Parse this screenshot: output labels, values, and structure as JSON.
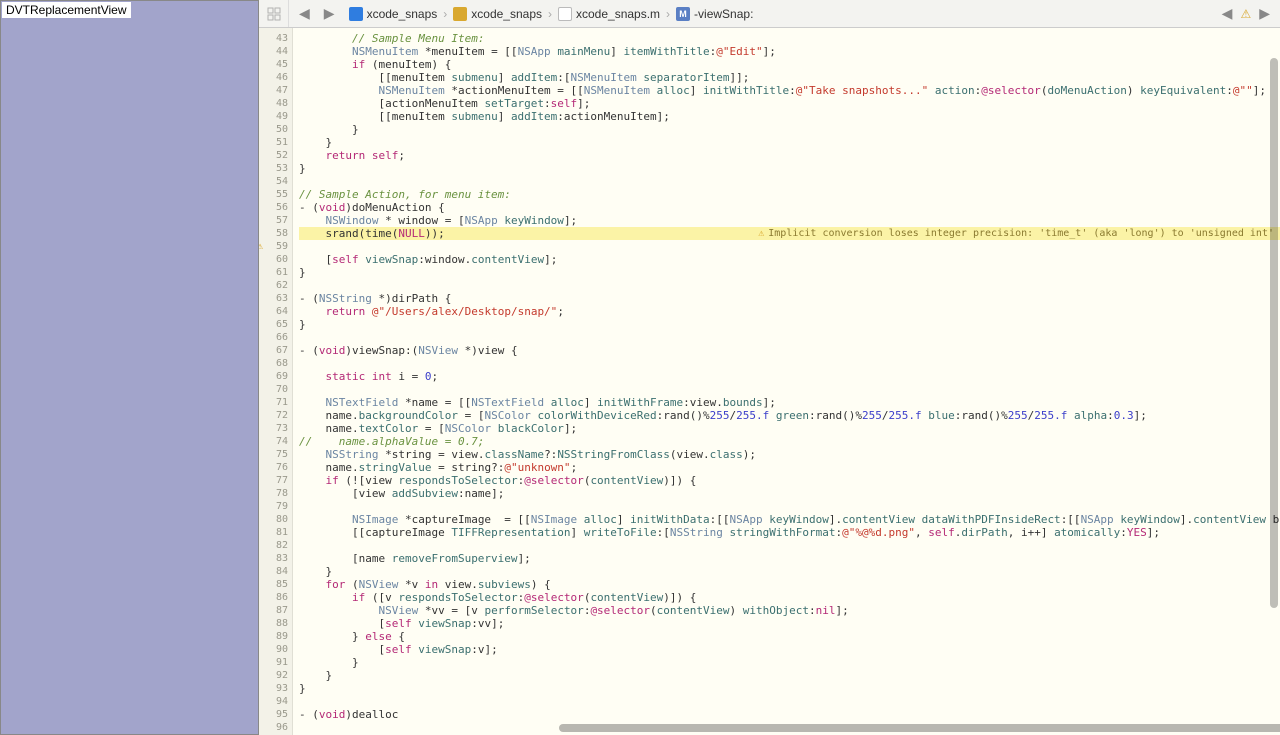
{
  "left": {
    "title": "DVTReplacementView"
  },
  "breadcrumb": {
    "items": [
      {
        "icon": "ic-blue",
        "letter": "",
        "label": "xcode_snaps"
      },
      {
        "icon": "ic-yellow",
        "letter": "",
        "label": "xcode_snaps"
      },
      {
        "icon": "ic-m",
        "letter": "m",
        "label": "xcode_snaps.m"
      },
      {
        "icon": "ic-meth",
        "letter": "M",
        "label": "-viewSnap:"
      }
    ]
  },
  "issue": {
    "text": "Implicit conversion loses integer precision: 'time_t' (aka 'long') to 'unsigned int'"
  },
  "gutter": {
    "start": 43,
    "end": 96,
    "warn": 59
  },
  "code": [
    {
      "i": "        ",
      "h": "<span class='cmt'>// Sample Menu Item:</span>"
    },
    {
      "i": "        ",
      "h": "<span class='ty'>NSMenuItem</span> *menuItem = [[<span class='ty'>NSApp</span> <span class='fn'>mainMenu</span>] <span class='fn'>itemWithTitle</span>:<span class='st'>@\"Edit\"</span>];"
    },
    {
      "i": "        ",
      "h": "<span class='kw'>if</span> (menuItem) {"
    },
    {
      "i": "            ",
      "h": "[[menuItem <span class='fn'>submenu</span>] <span class='fn'>addItem</span>:[<span class='ty'>NSMenuItem</span> <span class='fn'>separatorItem</span>]];"
    },
    {
      "i": "            ",
      "h": "<span class='ty'>NSMenuItem</span> *actionMenuItem = [[<span class='ty'>NSMenuItem</span> <span class='fn'>alloc</span>] <span class='fn'>initWithTitle</span>:<span class='st'>@\"Take snapshots...\"</span> <span class='fn'>action</span>:<span class='kw'>@selector</span>(<span class='sel'>doMenuAction</span>) <span class='fn'>keyEquivalent</span>:<span class='st'>@\"\"</span>];"
    },
    {
      "i": "            ",
      "h": "[actionMenuItem <span class='fn'>setTarget</span>:<span class='kw'>self</span>];"
    },
    {
      "i": "            ",
      "h": "[[menuItem <span class='fn'>submenu</span>] <span class='fn'>addItem</span>:actionMenuItem];"
    },
    {
      "i": "        ",
      "h": "}"
    },
    {
      "i": "    ",
      "h": "}"
    },
    {
      "i": "    ",
      "h": "<span class='kw'>return</span> <span class='kw'>self</span>;"
    },
    {
      "i": "",
      "h": "}"
    },
    {
      "i": "",
      "h": ""
    },
    {
      "i": "",
      "h": "<span class='cmt'>// Sample Action, for menu item:</span>"
    },
    {
      "i": "",
      "h": "- (<span class='kw'>void</span>)doMenuAction {"
    },
    {
      "i": "    ",
      "h": "<span class='ty'>NSWindow</span> * window = [<span class='ty'>NSApp</span> <span class='fn'>keyWindow</span>];"
    },
    {
      "i": "    ",
      "h": "srand(time(<span class='kw'>NULL</span>));",
      "hl": true,
      "issue": true
    },
    {
      "i": "",
      "h": ""
    },
    {
      "i": "    ",
      "h": "[<span class='kw'>self</span> <span class='fn'>viewSnap</span>:window.<span class='fn'>contentView</span>];"
    },
    {
      "i": "",
      "h": "}"
    },
    {
      "i": "",
      "h": ""
    },
    {
      "i": "",
      "h": "- (<span class='ty'>NSString</span> *)dirPath {"
    },
    {
      "i": "    ",
      "h": "<span class='kw'>return</span> <span class='st'>@\"/Users/alex/Desktop/snap/\"</span>;"
    },
    {
      "i": "",
      "h": "}"
    },
    {
      "i": "",
      "h": ""
    },
    {
      "i": "",
      "h": "- (<span class='kw'>void</span>)viewSnap:(<span class='ty'>NSView</span> *)view {"
    },
    {
      "i": "",
      "h": ""
    },
    {
      "i": "    ",
      "h": "<span class='kw'>static</span> <span class='kw'>int</span> i = <span class='nm'>0</span>;"
    },
    {
      "i": "",
      "h": ""
    },
    {
      "i": "    ",
      "h": "<span class='ty'>NSTextField</span> *name = [[<span class='ty'>NSTextField</span> <span class='fn'>alloc</span>] <span class='fn'>initWithFrame</span>:view.<span class='fn'>bounds</span>];"
    },
    {
      "i": "    ",
      "h": "name.<span class='fn'>backgroundColor</span> = [<span class='ty'>NSColor</span> <span class='fn'>colorWithDeviceRed</span>:rand()%<span class='nm'>255</span>/<span class='nm'>255.f</span> <span class='fn'>green</span>:rand()%<span class='nm'>255</span>/<span class='nm'>255.f</span> <span class='fn'>blue</span>:rand()%<span class='nm'>255</span>/<span class='nm'>255.f</span> <span class='fn'>alpha</span>:<span class='nm'>0.3</span>];"
    },
    {
      "i": "    ",
      "h": "name.<span class='fn'>textColor</span> = [<span class='ty'>NSColor</span> <span class='fn'>blackColor</span>];"
    },
    {
      "i": "",
      "h": "<span class='cmt'>//    name.alphaValue = 0.7;</span>"
    },
    {
      "i": "    ",
      "h": "<span class='ty'>NSString</span> *string = view.<span class='fn'>className</span>?:<span class='fn'>NSStringFromClass</span>(view.<span class='fn'>class</span>);"
    },
    {
      "i": "    ",
      "h": "name.<span class='fn'>stringValue</span> = string?:<span class='st'>@\"unknown\"</span>;"
    },
    {
      "i": "    ",
      "h": "<span class='kw'>if</span> (![view <span class='fn'>respondsToSelector</span>:<span class='kw'>@selector</span>(<span class='sel'>contentView</span>)]) {"
    },
    {
      "i": "        ",
      "h": "[view <span class='fn'>addSubview</span>:name];"
    },
    {
      "i": "",
      "h": ""
    },
    {
      "i": "        ",
      "h": "<span class='ty'>NSImage</span> *captureImage  = [[<span class='ty'>NSImage</span> <span class='fn'>alloc</span>] <span class='fn'>initWithData</span>:[[<span class='ty'>NSApp</span> <span class='fn'>keyWindow</span>].<span class='fn'>contentView</span> <span class='fn'>dataWithPDFInsideRect</span>:[[<span class='ty'>NSApp</span> <span class='fn'>keyWindow</span>].<span class='fn'>contentView</span> b"
    },
    {
      "i": "        ",
      "h": "[[captureImage <span class='fn'>TIFFRepresentation</span>] <span class='fn'>writeToFile</span>:[<span class='ty'>NSString</span> <span class='fn'>stringWithFormat</span>:<span class='st'>@\"%@%d.png\"</span>, <span class='kw'>self</span>.<span class='fn'>dirPath</span>, i++] <span class='fn'>atomically</span>:<span class='kw'>YES</span>];"
    },
    {
      "i": "",
      "h": ""
    },
    {
      "i": "        ",
      "h": "[name <span class='fn'>removeFromSuperview</span>];"
    },
    {
      "i": "    ",
      "h": "}"
    },
    {
      "i": "    ",
      "h": "<span class='kw'>for</span> (<span class='ty'>NSView</span> *v <span class='kw'>in</span> view.<span class='fn'>subviews</span>) {"
    },
    {
      "i": "        ",
      "h": "<span class='kw'>if</span> ([v <span class='fn'>respondsToSelector</span>:<span class='kw'>@selector</span>(<span class='sel'>contentView</span>)]) {"
    },
    {
      "i": "            ",
      "h": "<span class='ty'>NSView</span> *vv = [v <span class='fn'>performSelector</span>:<span class='kw'>@selector</span>(<span class='sel'>contentView</span>) <span class='fn'>withObject</span>:<span class='kw'>nil</span>];"
    },
    {
      "i": "            ",
      "h": "[<span class='kw'>self</span> <span class='fn'>viewSnap</span>:vv];"
    },
    {
      "i": "        ",
      "h": "} <span class='kw'>else</span> {"
    },
    {
      "i": "            ",
      "h": "[<span class='kw'>self</span> <span class='fn'>viewSnap</span>:v];"
    },
    {
      "i": "        ",
      "h": "}"
    },
    {
      "i": "    ",
      "h": "}"
    },
    {
      "i": "",
      "h": "}"
    },
    {
      "i": "",
      "h": ""
    },
    {
      "i": "",
      "h": "- (<span class='kw'>void</span>)dealloc"
    }
  ]
}
